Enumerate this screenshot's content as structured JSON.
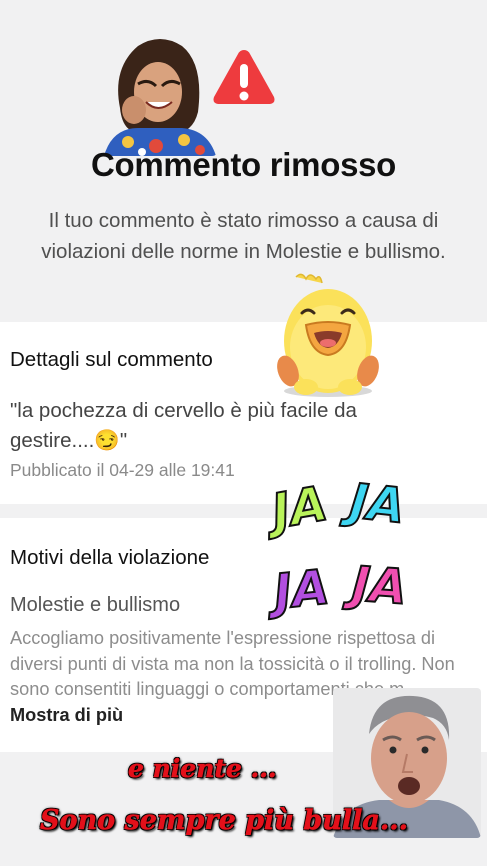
{
  "notice": {
    "title": "Commento rimosso",
    "message": "Il tuo commento è stato rimosso a causa di violazioni delle norme in Molestie e bullismo.",
    "warning_color": "#ee3b3e",
    "icon": "warning-triangle-icon"
  },
  "comment_details": {
    "heading": "Dettagli sul commento",
    "text": "\"la pochezza di cervello è più facile da gestire....😏\"",
    "published": "Pubblicato il 04-29 alle 19:41"
  },
  "violation": {
    "heading": "Motivi della violazione",
    "category": "Molestie e bullismo",
    "description": "Accogliamo positivamente l'espressione rispettosa di diversi punti di vista ma non la tossicità o il trolling. Non sono consentiti linguaggi o comportamenti che m...",
    "more_label": "Mostra di più"
  },
  "stickers": {
    "jaja": [
      "JA",
      "JA",
      "JA",
      "JA"
    ],
    "jaja_colors": [
      "#b9f35a",
      "#3ed6f2",
      "#b24fe0",
      "#f04fb0"
    ],
    "caption_line1": "e niente ...",
    "caption_line2": "Sono sempre più bulla..."
  }
}
